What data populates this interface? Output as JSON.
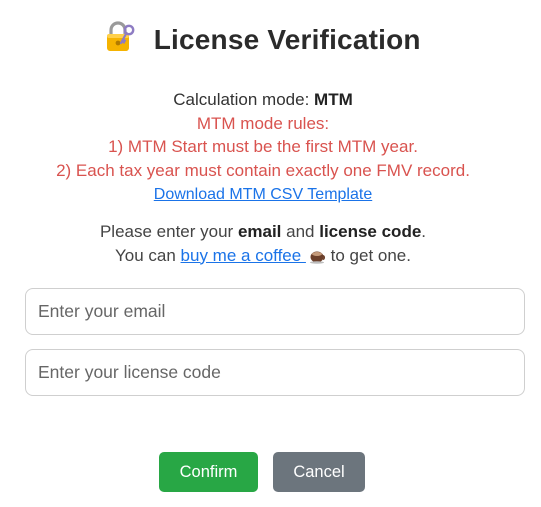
{
  "dialog": {
    "title": "License Verification",
    "title_icon": "locked-with-key-icon"
  },
  "info": {
    "mode_label": "Calculation mode: ",
    "mode_value": "MTM",
    "rules_heading": "MTM mode rules:",
    "rules": [
      "1) MTM Start must be the first MTM year.",
      "2) Each tax year must contain exactly one FMV record."
    ],
    "download_link": "Download MTM CSV Template"
  },
  "prompt": {
    "line1_prefix": "Please enter your ",
    "line1_email": "email",
    "line1_and": " and ",
    "line1_license": "license code",
    "line1_suffix": ".",
    "line2_prefix": "You can ",
    "coffee_link": "buy me a coffee ",
    "coffee_icon": "coffee-cup-icon",
    "line2_suffix": " to get one."
  },
  "form": {
    "email_placeholder": "Enter your email",
    "email_value": "",
    "license_placeholder": "Enter your license code",
    "license_value": ""
  },
  "buttons": {
    "confirm_label": "Confirm",
    "cancel_label": "Cancel"
  },
  "colors": {
    "rule_text": "#d9534f",
    "link": "#1a73e8",
    "confirm_bg": "#28a745",
    "cancel_bg": "#6c757d"
  }
}
